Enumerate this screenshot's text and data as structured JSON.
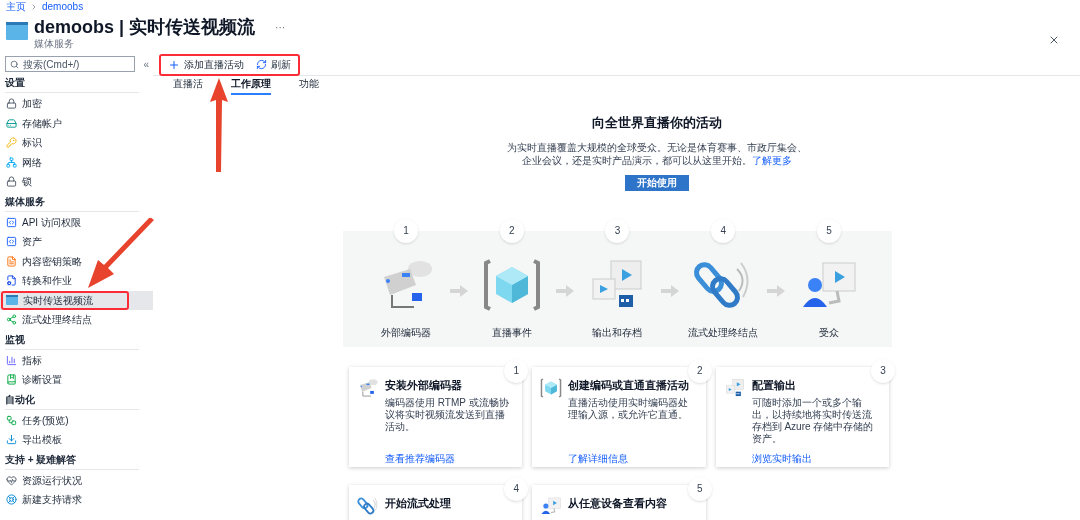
{
  "breadcrumb": [
    {
      "label": "主页"
    },
    {
      "label": "demoobs"
    }
  ],
  "header": {
    "title": "demoobs | 实时传送视频流",
    "subtitle": "媒体服务",
    "more": "···"
  },
  "sidebar": {
    "search": {
      "placeholder": "搜索(Cmd+/)"
    },
    "collapse": "«",
    "sections": [
      {
        "title": "设置",
        "items": [
          {
            "label": "加密",
            "kind": "lock",
            "selected": false
          },
          {
            "label": "存储帐户",
            "kind": "storage",
            "selected": false
          },
          {
            "label": "标识",
            "kind": "identity",
            "selected": false
          },
          {
            "label": "网络",
            "kind": "network",
            "selected": false
          },
          {
            "label": "锁",
            "kind": "lock",
            "selected": false
          }
        ]
      },
      {
        "title": "媒体服务",
        "items": [
          {
            "label": "API 访问权限",
            "kind": "api",
            "selected": false
          },
          {
            "label": "资产",
            "kind": "api",
            "selected": false
          },
          {
            "label": "内容密钥策略",
            "kind": "policy",
            "selected": false
          },
          {
            "label": "转换和作业",
            "kind": "transform",
            "selected": false
          },
          {
            "label": "实时传送视频流",
            "kind": "live",
            "selected": true
          },
          {
            "label": "流式处理终结点",
            "kind": "endpoint",
            "selected": false
          }
        ]
      },
      {
        "title": "监视",
        "items": [
          {
            "label": "指标",
            "kind": "metrics",
            "selected": false
          },
          {
            "label": "诊断设置",
            "kind": "diagnostics",
            "selected": false
          }
        ]
      },
      {
        "title": "自动化",
        "items": [
          {
            "label": "任务(预览)",
            "kind": "tasks",
            "selected": false
          },
          {
            "label": "导出模板",
            "kind": "template",
            "selected": false
          }
        ]
      },
      {
        "title": "支持 + 疑难解答",
        "items": [
          {
            "label": "资源运行状况",
            "kind": "health",
            "selected": false
          },
          {
            "label": "新建支持请求",
            "kind": "support",
            "selected": false
          }
        ]
      }
    ]
  },
  "toolbar": [
    {
      "label": "添加直播活动",
      "kind": "add"
    },
    {
      "label": "刷新",
      "kind": "refresh"
    }
  ],
  "tabs": [
    {
      "label": "直播活",
      "selected": false
    },
    {
      "label": "工作原理",
      "selected": true
    },
    {
      "label": "功能",
      "selected": false
    }
  ],
  "hero": {
    "title": "向全世界直播你的活动",
    "description": "为实时直播覆盖大规模的全球受众。无论是体育赛事、市政厅集会、企业会议，还是实时产品演示，都可以从这里开始。",
    "link": "了解更多",
    "button": "开始使用"
  },
  "steps": [
    {
      "number": "1",
      "label": "外部编码器",
      "kind": "encoder"
    },
    {
      "number": "2",
      "label": "直播事件",
      "kind": "event"
    },
    {
      "number": "3",
      "label": "输出和存档",
      "kind": "output"
    },
    {
      "number": "4",
      "label": "流式处理终结点",
      "kind": "endpoint"
    },
    {
      "number": "5",
      "label": "受众",
      "kind": "audience"
    }
  ],
  "cards": [
    {
      "number": "1",
      "title": "安装外部编码器",
      "description": "编码器使用 RTMP 或流畅协议将实时视频流发送到直播活动。",
      "link": "查看推荐编码器",
      "kind": "encoder"
    },
    {
      "number": "2",
      "title": "创建编码或直通直播活动",
      "description": "直播活动使用实时编码器处理输入源，或允许它直通。",
      "link": "了解详细信息",
      "kind": "event"
    },
    {
      "number": "3",
      "title": "配置输出",
      "description": "可随时添加一个或多个输出，以持续地将实时传送流存档到 Azure 存储中存储的资产。",
      "link": "浏览实时输出",
      "kind": "output"
    },
    {
      "number": "4",
      "title": "开始流式处理",
      "kind": "endpoint"
    },
    {
      "number": "5",
      "title": "从任意设备查看内容",
      "kind": "audience"
    }
  ]
}
